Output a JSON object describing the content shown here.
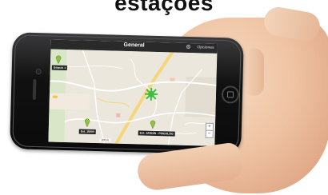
{
  "heading": "estações",
  "app": {
    "title": "General",
    "options_label": "Opciones",
    "icons": {
      "gear": "gear-icon",
      "pin": "map-pin-icon",
      "zoom_in": "plus-icon",
      "zoom_out": "minus-icon"
    }
  },
  "map": {
    "markers": [
      {
        "label": "Estació 1"
      },
      {
        "label": "Est. 15000"
      },
      {
        "label": "Est. JARDÍN - PSICOLÓG"
      }
    ],
    "zoom_in": "+",
    "zoom_out": "−",
    "scale_text": "100 m"
  },
  "colors": {
    "marker": "#8cc63f",
    "active_station": "#3fbf3f",
    "topbar": "#2a2a2a"
  }
}
